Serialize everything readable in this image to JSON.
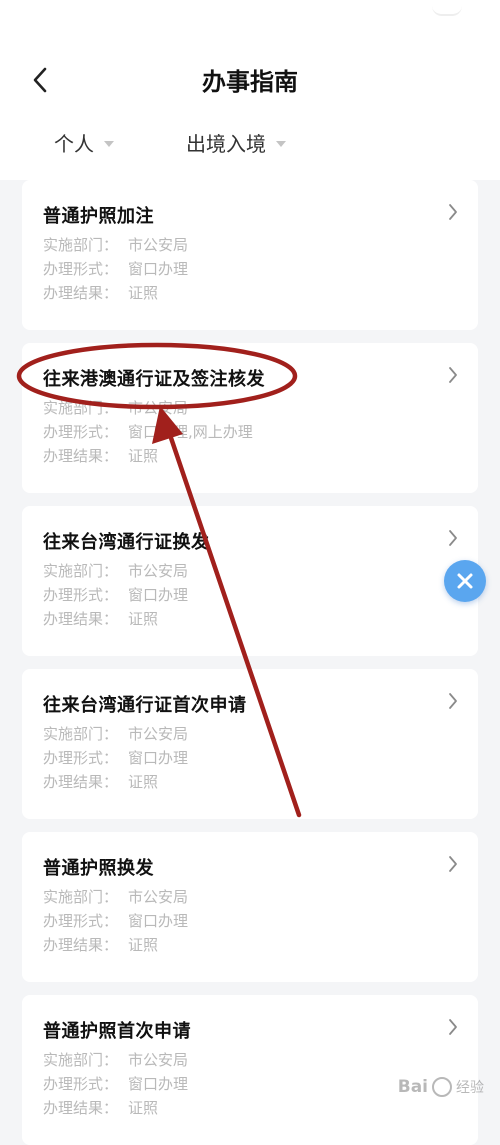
{
  "header": {
    "title": "办事指南",
    "filters": [
      {
        "label": "个人"
      },
      {
        "label": "出境入境"
      }
    ]
  },
  "field_labels": {
    "dept": "实施部门：",
    "form": "办理形式：",
    "result": "办理结果："
  },
  "items": [
    {
      "title": "普通护照加注",
      "dept": "市公安局",
      "form": "窗口办理",
      "result": "证照"
    },
    {
      "title": "往来港澳通行证及签注核发",
      "dept": "市公安局",
      "form": "窗口办理,网上办理",
      "result": "证照"
    },
    {
      "title": "往来台湾通行证换发",
      "dept": "市公安局",
      "form": "窗口办理",
      "result": "证照"
    },
    {
      "title": "往来台湾通行证首次申请",
      "dept": "市公安局",
      "form": "窗口办理",
      "result": "证照"
    },
    {
      "title": "普通护照换发",
      "dept": "市公安局",
      "form": "窗口办理",
      "result": "证照"
    },
    {
      "title": "普通护照首次申请",
      "dept": "市公安局",
      "form": "窗口办理",
      "result": "证照"
    }
  ],
  "annotation": {
    "color": "#a1201c"
  },
  "watermark": {
    "brand": "Bai",
    "suffix": "经验"
  },
  "icons": {
    "back": "chevron-left-icon",
    "item_arrow": "chevron-right-icon",
    "filter_caret": "caret-down-icon",
    "close": "close-icon"
  }
}
